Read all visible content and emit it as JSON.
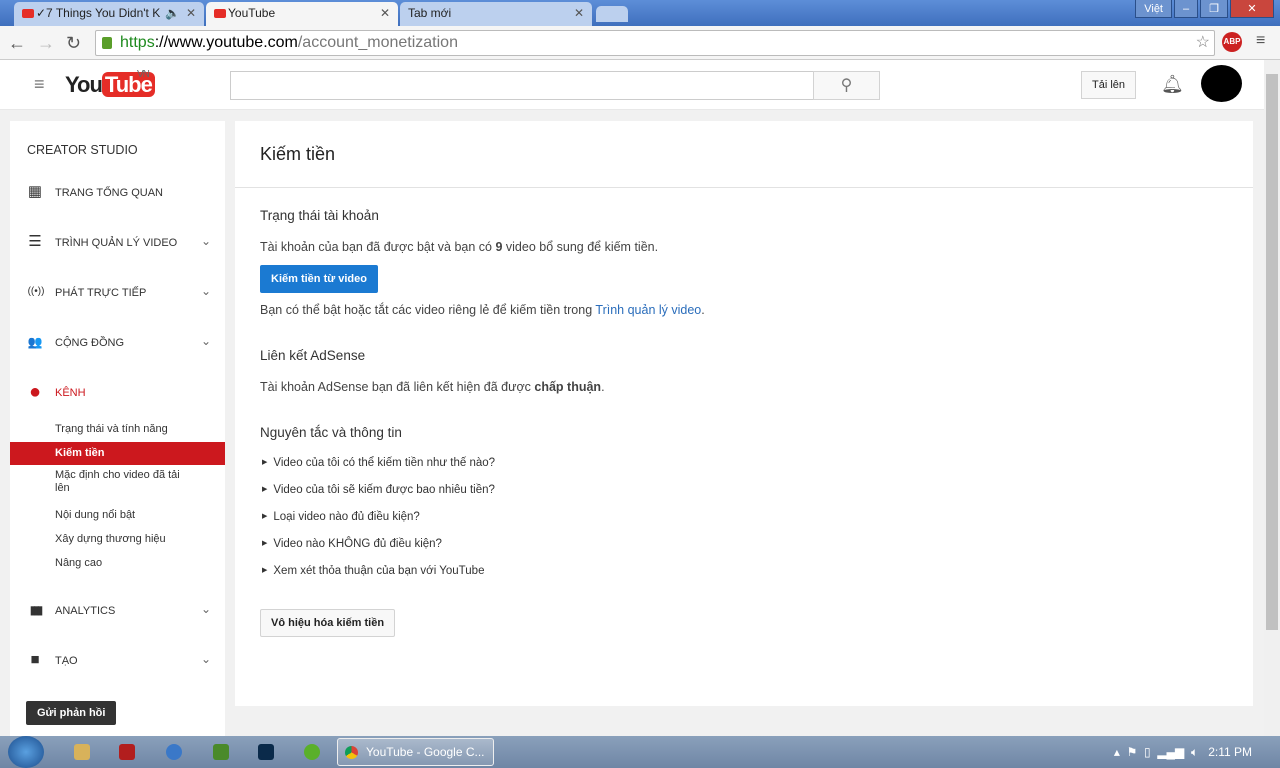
{
  "browser": {
    "tabs": [
      {
        "title": "✓7 Things You Didn't K",
        "audio": true
      },
      {
        "title": "YouTube",
        "active": true
      },
      {
        "title": "Tab mới"
      }
    ],
    "lang_indicator": "Việt",
    "url": {
      "scheme": "https",
      "host": "://www.youtube.com",
      "path": "/account_monetization"
    },
    "abp_label": "ABP"
  },
  "header": {
    "logo_you": "You",
    "logo_tube": "Tube",
    "region": "VN",
    "search_placeholder": "",
    "upload_label": "Tải lên"
  },
  "sidebar": {
    "title": "CREATOR STUDIO",
    "items": [
      {
        "label": "TRANG TỔNG QUAN",
        "icon": "dashboard-icon",
        "glyph": "▦"
      },
      {
        "label": "TRÌNH QUẢN LÝ VIDEO",
        "icon": "video-manager-icon",
        "glyph": "☰",
        "chevron": true
      },
      {
        "label": "PHÁT TRỰC TIẾP",
        "icon": "live-icon",
        "glyph": "((•))",
        "chevron": true
      },
      {
        "label": "CỘNG ĐỒNG",
        "icon": "community-icon",
        "glyph": "👥",
        "chevron": true
      },
      {
        "label": "KÊNH",
        "icon": "channel-icon",
        "glyph": "●"
      },
      {
        "label": "ANALYTICS",
        "icon": "analytics-icon",
        "glyph": "▮",
        "chevron": true
      },
      {
        "label": "TẠO",
        "icon": "create-icon",
        "glyph": "■",
        "chevron": true
      }
    ],
    "sub": [
      "Trạng thái và tính năng",
      "Kiếm tiền",
      "Mặc định cho video đã tải lên",
      "Nội dung nổi bật",
      "Xây dựng thương hiệu",
      "Nâng cao"
    ],
    "feedback": "Gửi phản hồi"
  },
  "main": {
    "title": "Kiếm tiền",
    "status_heading": "Trạng thái tài khoản",
    "status_text_a": "Tài khoản của bạn đã được bật và bạn có ",
    "status_count": "9",
    "status_text_b": " video bổ sung để kiếm tiền.",
    "monetize_button": "Kiếm tiền từ video",
    "toggle_text": "Bạn có thể bật hoặc tắt các video riêng lẻ để kiếm tiền trong ",
    "toggle_link": "Trình quản lý video",
    "toggle_end": ".",
    "adsense_heading": "Liên kết AdSense",
    "adsense_text": "Tài khoản AdSense bạn đã liên kết hiện đã được ",
    "adsense_status": "chấp thuận",
    "adsense_end": ".",
    "guide_heading": "Nguyên tắc và thông tin",
    "guide_items": [
      "Video của tôi có thể kiếm tiền như thế nào?",
      "Video của tôi sẽ kiếm được bao nhiêu tiền?",
      "Loại video nào đủ điều kiện?",
      "Video nào KHÔNG đủ điều kiện?",
      "Xem xét thỏa thuận của bạn với YouTube"
    ],
    "disable_button": "Vô hiệu hóa kiếm tiền"
  },
  "taskbar": {
    "active_app": "YouTube - Google C...",
    "clock": "2:11 PM"
  },
  "colors": {
    "youtube_red": "#e52d27",
    "active_red": "#cc181e",
    "button_blue": "#1b7ad2",
    "link": "#2a6dbb"
  }
}
